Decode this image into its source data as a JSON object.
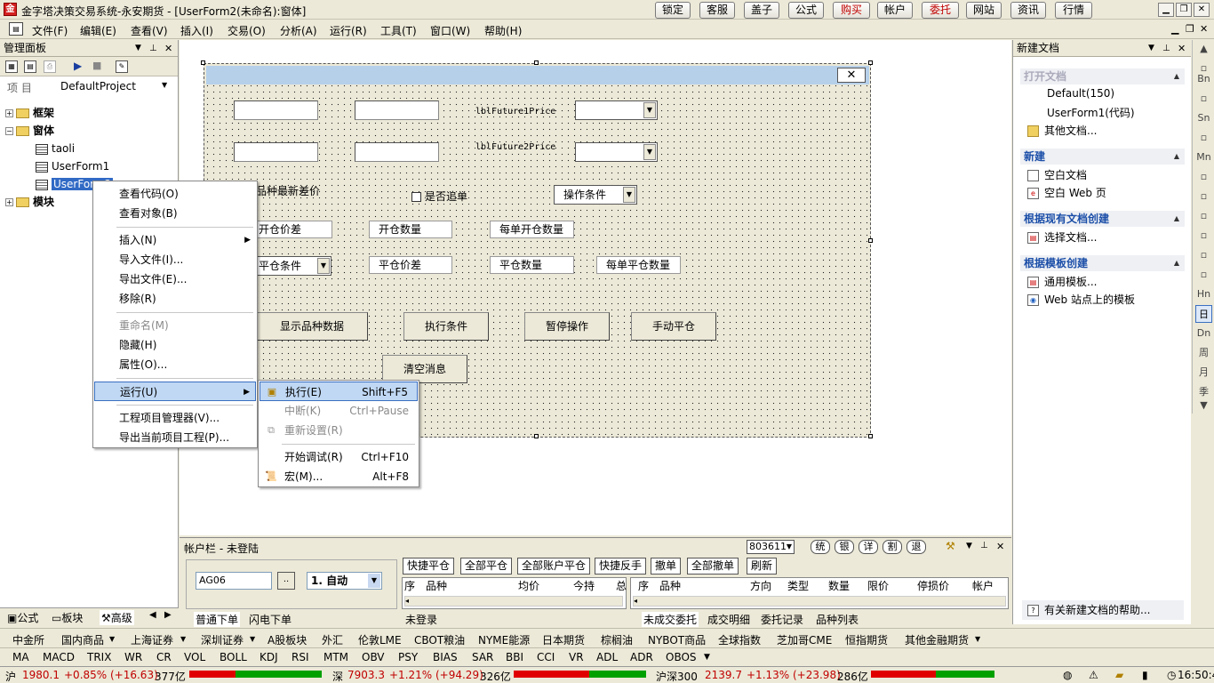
{
  "window": {
    "title": "金字塔决策交易系统-永安期货 - [UserForm2(未命名):窗体]"
  },
  "toolbar": [
    {
      "label": "锁定",
      "highlight": false
    },
    {
      "label": "客服",
      "highlight": false
    },
    {
      "label": "盖子",
      "highlight": false
    },
    {
      "label": "公式",
      "highlight": false
    },
    {
      "label": "购买",
      "highlight": true
    },
    {
      "label": "帐户",
      "highlight": false
    },
    {
      "label": "委托",
      "highlight": true
    },
    {
      "label": "网站",
      "highlight": false
    },
    {
      "label": "资讯",
      "highlight": false
    },
    {
      "label": "行情",
      "highlight": false
    }
  ],
  "menu": [
    "文件(F)",
    "编辑(E)",
    "查看(V)",
    "插入(I)",
    "交易(O)",
    "分析(A)",
    "运行(R)",
    "工具(T)",
    "窗口(W)",
    "帮助(H)"
  ],
  "left_panel": {
    "title": "管理面板",
    "project_label": "项 目",
    "project_value": "DefaultProject",
    "tree": {
      "frame": "框架",
      "forms": "窗体",
      "taoli": "taoli",
      "userform1": "UserForm1",
      "userform2": "UserForm2",
      "module": "模块"
    },
    "tabs": {
      "formula": "公式",
      "block": "板块",
      "advanced": "高级"
    }
  },
  "context_menu": {
    "view_code": "查看代码(O)",
    "view_object": "查看对象(B)",
    "insert": "插入(N)",
    "import": "导入文件(I)...",
    "export": "导出文件(E)...",
    "remove": "移除(R)",
    "rename": "重命名(M)",
    "hide": "隐藏(H)",
    "properties": "属性(O)...",
    "run": "运行(U)",
    "project_manager": "工程项目管理器(V)...",
    "export_project": "导出当前项目工程(P)..."
  },
  "submenu": {
    "execute": "执行(E)",
    "execute_sc": "Shift+F5",
    "break": "中断(K)",
    "break_sc": "Ctrl+Pause",
    "reset": "重新设置(R)",
    "debug": "开始调试(R)",
    "debug_sc": "Ctrl+F10",
    "macro": "宏(M)...",
    "macro_sc": "Alt+F8"
  },
  "form": {
    "close": "✕",
    "lbl_price1": "lblFuture1Price",
    "lbl_price2": "lblFuture2Price",
    "spread_label": "品种最新差价",
    "chase_label": "是否追单",
    "op_condition": "操作条件",
    "open_spread": "开仓价差",
    "open_qty": "开仓数量",
    "per_open_qty": "每单开仓数量",
    "close_condition": "平仓条件",
    "close_spread": "平仓价差",
    "close_qty": "平仓数量",
    "per_close_qty": "每单平仓数量",
    "btn_show": "显示品种数据",
    "btn_exec": "执行条件",
    "btn_pause": "暂停操作",
    "btn_manual": "手动平仓",
    "btn_clear": "清空消息"
  },
  "right_panel": {
    "title": "新建文档",
    "open_doc": "打开文档",
    "recent": [
      "Default(150)",
      "UserForm1(代码)"
    ],
    "other_docs": "其他文档...",
    "new": "新建",
    "blank_doc": "空白文档",
    "blank_web": "空白 Web 页",
    "from_existing": "根据现有文档创建",
    "choose_doc": "选择文档...",
    "from_template": "根据模板创建",
    "general_tpl": "通用模板...",
    "web_tpl": "Web 站点上的模板",
    "help": "有关新建文档的帮助..."
  },
  "right_bar": [
    "Bn",
    "Sn",
    "Mn",
    "Hn",
    "日",
    "Dn",
    "周",
    "月",
    "季"
  ],
  "account": {
    "title": "帐户栏 - 未登陆",
    "account_id": "803611",
    "buttons": [
      "统",
      "银",
      "详",
      "割",
      "退"
    ],
    "contract": "AG06",
    "mode": "1. 自动",
    "actions": [
      "快捷平仓",
      "全部平仓",
      "全部账户平仓",
      "快捷反手",
      "撤单",
      "全部撤单",
      "刷新"
    ],
    "pos_cols": [
      "序",
      "品种",
      "均价",
      "今持",
      "总"
    ],
    "order_cols": [
      "序",
      "品种",
      "方向",
      "类型",
      "数量",
      "限价",
      "停损价",
      "帐户"
    ],
    "not_logged": "未登录",
    "tabs_left": [
      "普通下单",
      "闪电下单"
    ],
    "tabs_right": [
      "未成交委托",
      "成交明细",
      "委托记录",
      "品种列表"
    ]
  },
  "markets": [
    "中金所",
    "国内商品",
    "上海证券",
    "深圳证券",
    "A股板块",
    "外汇",
    "伦敦LME",
    "CBOT粮油",
    "NYME能源",
    "日本期货",
    "棕榈油",
    "NYBOT商品",
    "全球指数",
    "芝加哥CME",
    "恒指期货",
    "其他金融期货"
  ],
  "indicators": [
    "MA",
    "MACD",
    "TRIX",
    "WR",
    "CR",
    "VOL",
    "BOLL",
    "KDJ",
    "RSI",
    "MTM",
    "OBV",
    "PSY",
    "BIAS",
    "SAR",
    "BBI",
    "CCI",
    "VR",
    "ADL",
    "ADR",
    "OBOS"
  ],
  "status": {
    "sh_label": "沪",
    "sh_value": "1980.1",
    "sh_change": "+0.85% (+16.63)",
    "sh_vol": "377亿",
    "sz_label": "深",
    "sz_value": "7903.3",
    "sz_change": "+1.21% (+94.29)",
    "sz_vol": "326亿",
    "hs_label": "沪深300",
    "hs_value": "2139.7",
    "hs_change": "+1.13% (+23.98)",
    "hs_vol": "286亿",
    "time": "16:50:40"
  }
}
